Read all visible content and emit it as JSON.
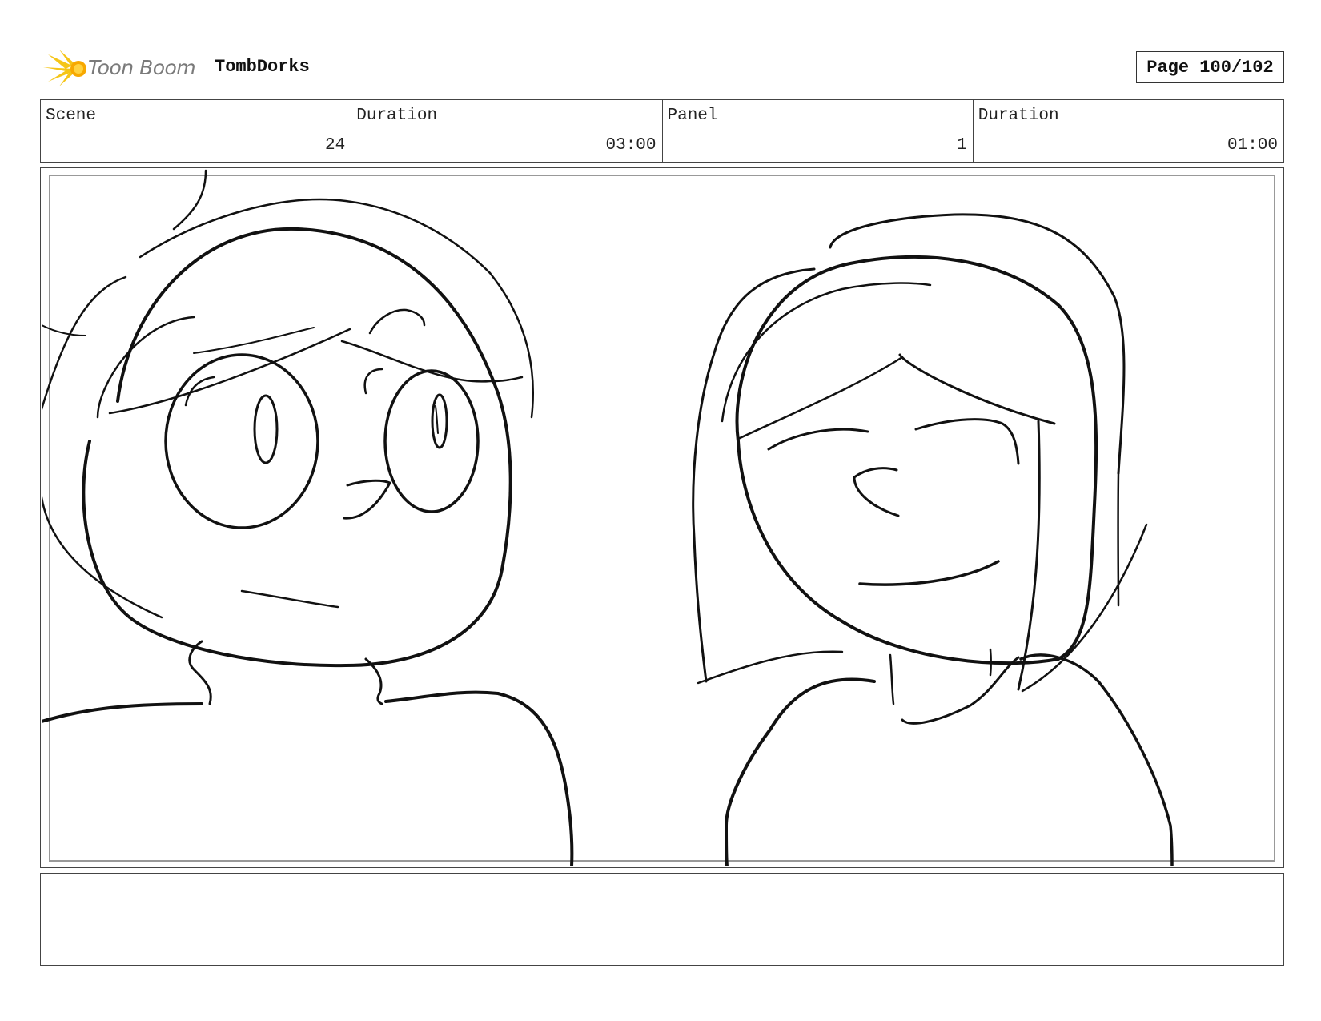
{
  "header": {
    "logo_text": "Toon Boom",
    "project_title": "TombDorks",
    "page_label": "Page 100/102"
  },
  "info": {
    "scene_label": "Scene",
    "scene_value": "24",
    "scene_duration_label": "Duration",
    "scene_duration_value": "03:00",
    "panel_label": "Panel",
    "panel_value": "1",
    "panel_duration_label": "Duration",
    "panel_duration_value": "01:00"
  },
  "colors": {
    "logo_star": "#f5c518",
    "logo_text": "#7a7a7a",
    "border": "#444444"
  },
  "notes": {
    "text": ""
  }
}
